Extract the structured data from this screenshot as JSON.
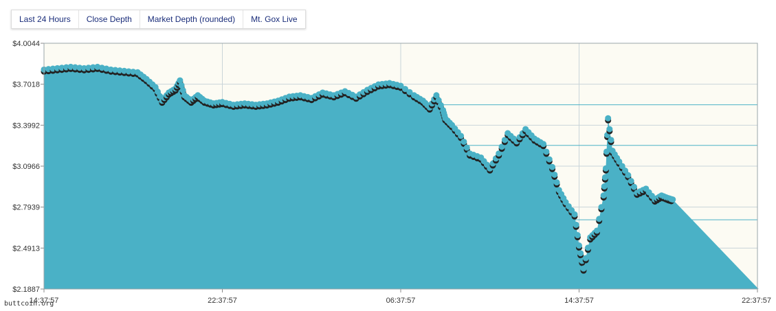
{
  "tabs": [
    {
      "label": "Last 24 Hours"
    },
    {
      "label": "Close Depth"
    },
    {
      "label": "Market Depth (rounded)"
    },
    {
      "label": "Mt. Gox Live"
    }
  ],
  "watermark": "buttcoin.org",
  "colors": {
    "series": "#4ab1c6",
    "plot_bg": "#fcfbf3",
    "grid": "#c9d4d8",
    "marker": "#222222"
  },
  "chart_data": {
    "type": "area",
    "xlabel": "",
    "ylabel": "",
    "y_ticks": [
      "$2.1887",
      "$2.4913",
      "$2.7939",
      "$3.0966",
      "$3.3992",
      "$3.7018",
      "$4.0044"
    ],
    "x_ticks": [
      "14:37:57",
      "22:37:57",
      "06:37:57",
      "14:37:57",
      "22:37:57"
    ],
    "ylim": [
      2.1887,
      4.0044
    ],
    "x_hours": [
      0,
      32
    ],
    "grid": true,
    "series": [
      {
        "points": [
          [
            0.0,
            3.81
          ],
          [
            0.6,
            3.82
          ],
          [
            1.2,
            3.83
          ],
          [
            1.8,
            3.82
          ],
          [
            2.4,
            3.83
          ],
          [
            3.0,
            3.81
          ],
          [
            3.6,
            3.8
          ],
          [
            4.2,
            3.79
          ],
          [
            4.6,
            3.74
          ],
          [
            5.0,
            3.68
          ],
          [
            5.3,
            3.58
          ],
          [
            5.6,
            3.64
          ],
          [
            5.9,
            3.67
          ],
          [
            6.1,
            3.73
          ],
          [
            6.3,
            3.62
          ],
          [
            6.6,
            3.58
          ],
          [
            6.9,
            3.62
          ],
          [
            7.2,
            3.58
          ],
          [
            7.6,
            3.56
          ],
          [
            8.0,
            3.57
          ],
          [
            8.5,
            3.55
          ],
          [
            9.0,
            3.56
          ],
          [
            9.5,
            3.55
          ],
          [
            10.0,
            3.56
          ],
          [
            10.5,
            3.58
          ],
          [
            11.0,
            3.61
          ],
          [
            11.5,
            3.62
          ],
          [
            12.0,
            3.6
          ],
          [
            12.5,
            3.64
          ],
          [
            13.0,
            3.62
          ],
          [
            13.5,
            3.65
          ],
          [
            14.0,
            3.61
          ],
          [
            14.5,
            3.66
          ],
          [
            15.0,
            3.7
          ],
          [
            15.5,
            3.71
          ],
          [
            16.0,
            3.69
          ],
          [
            16.6,
            3.62
          ],
          [
            17.0,
            3.58
          ],
          [
            17.3,
            3.53
          ],
          [
            17.6,
            3.62
          ],
          [
            17.9,
            3.51
          ],
          [
            18.0,
            3.45
          ],
          [
            18.3,
            3.4
          ],
          [
            18.7,
            3.32
          ],
          [
            19.1,
            3.19
          ],
          [
            19.6,
            3.16
          ],
          [
            20.0,
            3.08
          ],
          [
            20.4,
            3.19
          ],
          [
            20.8,
            3.34
          ],
          [
            21.2,
            3.28
          ],
          [
            21.6,
            3.37
          ],
          [
            22.0,
            3.3
          ],
          [
            22.4,
            3.26
          ],
          [
            22.8,
            3.09
          ],
          [
            23.1,
            2.92
          ],
          [
            23.4,
            2.83
          ],
          [
            23.8,
            2.74
          ],
          [
            24.0,
            2.51
          ],
          [
            24.2,
            2.34
          ],
          [
            24.5,
            2.57
          ],
          [
            24.8,
            2.62
          ],
          [
            25.1,
            2.88
          ],
          [
            25.2,
            3.08
          ],
          [
            25.3,
            3.45
          ],
          [
            25.5,
            3.21
          ],
          [
            25.8,
            3.13
          ],
          [
            26.2,
            3.03
          ],
          [
            26.6,
            2.9
          ],
          [
            27.0,
            2.93
          ],
          [
            27.4,
            2.85
          ],
          [
            27.7,
            2.88
          ],
          [
            28.0,
            2.86
          ],
          [
            28.2,
            2.85
          ]
        ]
      }
    ]
  }
}
